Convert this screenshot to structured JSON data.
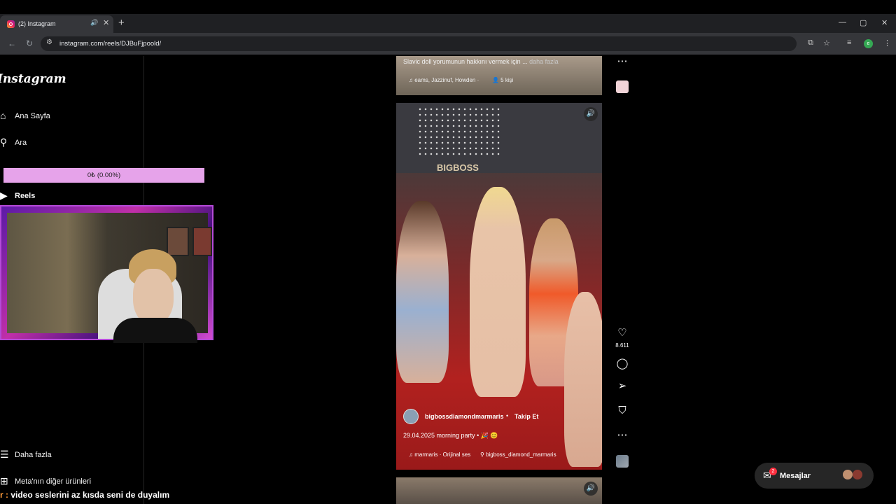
{
  "browser": {
    "tab_title": "(2) Instagram",
    "tab_audio_icon": "🔊",
    "tab_close": "✕",
    "new_tab": "+",
    "url": "instagram.com/reels/DJBuFjpoold/",
    "window_controls": [
      "—",
      "▢",
      "✕"
    ],
    "profile_initial": "e"
  },
  "sidebar": {
    "logo": "Instagram",
    "items": [
      {
        "label": "Ana Sayfa",
        "icon": "⌂"
      },
      {
        "label": "Ara",
        "icon": "⚲"
      },
      {
        "label": "Reels",
        "icon": "▶"
      },
      {
        "label": "Daha fazla",
        "icon": "☰"
      },
      {
        "label": "Meta'nın diğer ürünleri",
        "icon": "⊞"
      }
    ]
  },
  "overlay": {
    "progress_text": "0₺ (0.00%)",
    "progress_value": 0,
    "chat_user": "r :",
    "chat_message": "video seslerini az kısda seni de duyalım"
  },
  "reel_prev": {
    "caption": "Slavic doll yorumunun hakkını vermek için ...",
    "more": "daha fazla",
    "audio": "♫ eams, Jazzinuf, Howden ·",
    "people": "👤 5 kişi"
  },
  "reel": {
    "sign": "BIGBOSS",
    "username": "bigbossdiamondmarmaris",
    "separator": "•",
    "follow": "Takip Et",
    "caption": "29.04.2025 morning party  •  🎉 😊",
    "audio": "♫ marmaris · Orijinal ses",
    "location": "⚲ bigboss_diamond_marmaris",
    "sound_icon": "🔊"
  },
  "actions": {
    "like_count": "8.611",
    "icons": [
      "heart-icon",
      "comment-icon",
      "share-icon",
      "bookmark-icon",
      "more-icon"
    ]
  },
  "messages": {
    "label": "Mesajlar",
    "badge": "2"
  },
  "colors": {
    "accent_progress": "#e6a3ea",
    "badge": "#ff3040",
    "webcam_border": "#b54ad8"
  }
}
